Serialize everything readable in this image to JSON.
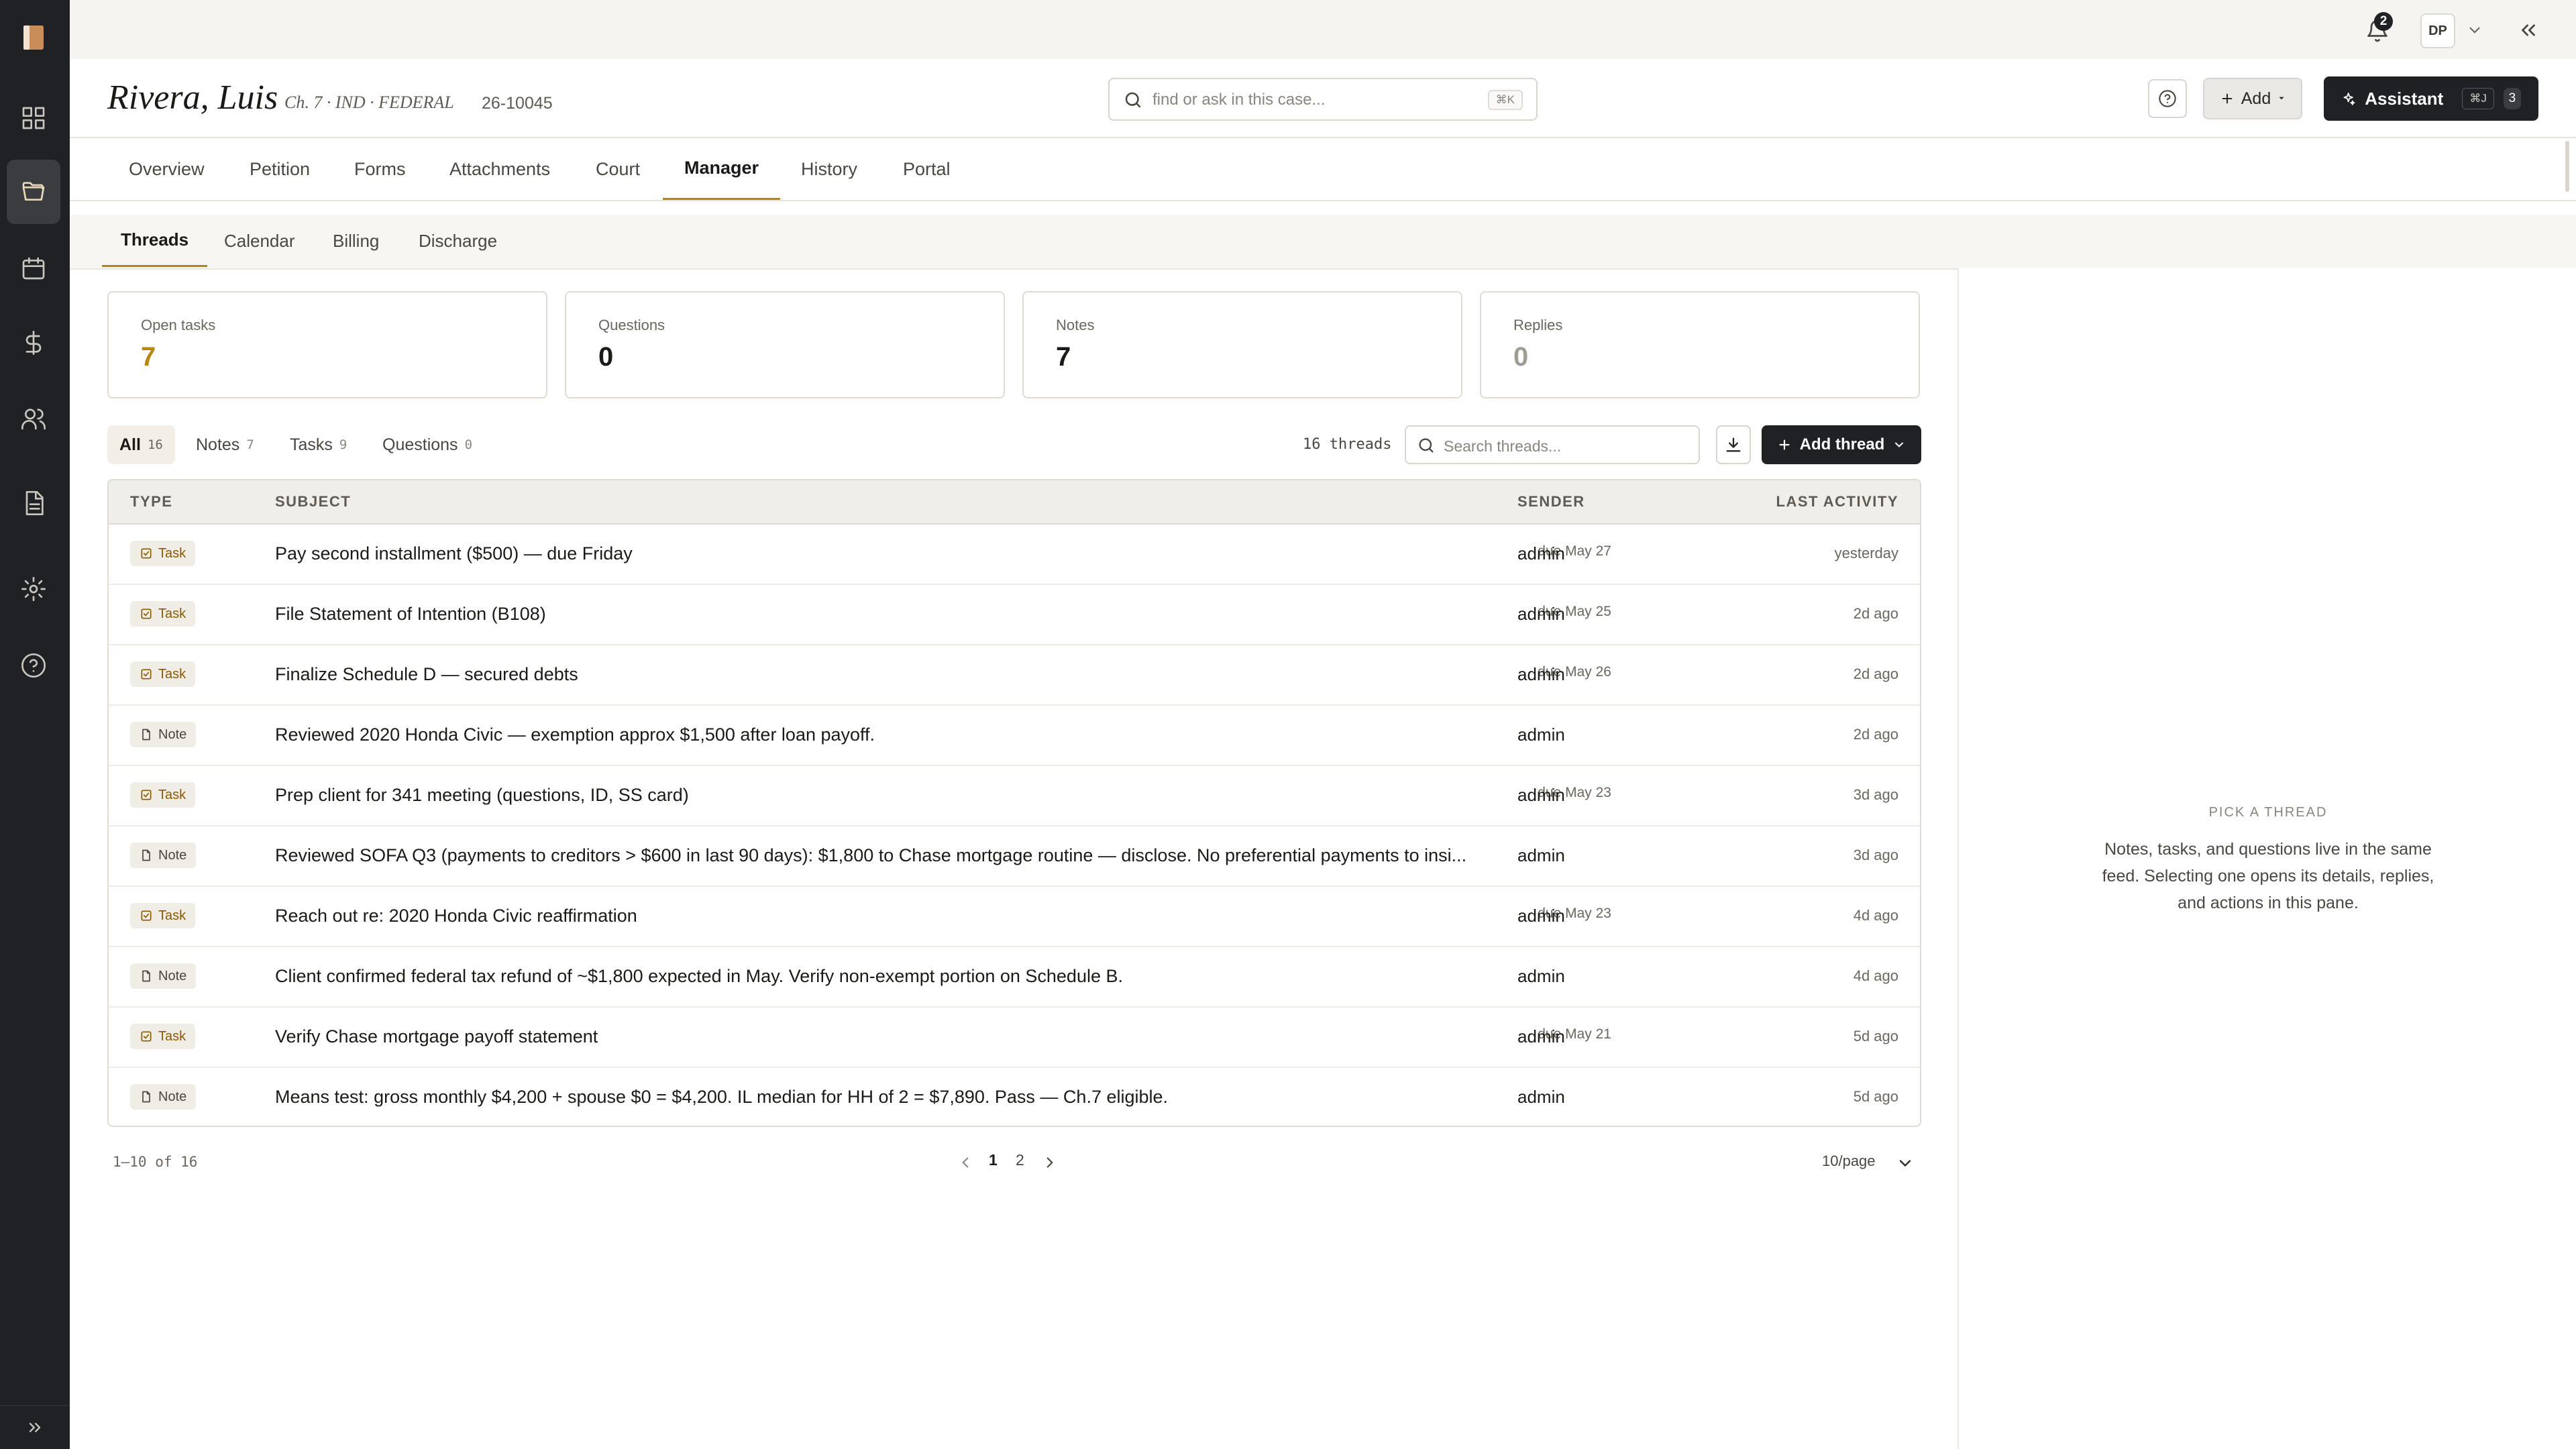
{
  "topbar": {
    "notification_count": "2",
    "avatar_initials": "DP"
  },
  "case": {
    "client_name": "Rivera, Luis",
    "meta": "Ch. 7 · IND · FEDERAL",
    "case_number": "26-10045",
    "search_placeholder": "find or ask in this case...",
    "search_shortcut": "⌘K"
  },
  "actions": {
    "add_label": "Add",
    "assistant_label": "Assistant",
    "assistant_shortcut": "⌘J",
    "assistant_count": "3"
  },
  "tabs": [
    {
      "label": "Overview"
    },
    {
      "label": "Petition"
    },
    {
      "label": "Forms"
    },
    {
      "label": "Attachments"
    },
    {
      "label": "Court"
    },
    {
      "label": "Manager"
    },
    {
      "label": "History"
    },
    {
      "label": "Portal"
    }
  ],
  "subtabs": [
    {
      "label": "Threads"
    },
    {
      "label": "Calendar"
    },
    {
      "label": "Billing"
    },
    {
      "label": "Discharge"
    }
  ],
  "stats": [
    {
      "label": "Open tasks",
      "value": "7"
    },
    {
      "label": "Questions",
      "value": "0"
    },
    {
      "label": "Notes",
      "value": "7"
    },
    {
      "label": "Replies",
      "value": "0"
    }
  ],
  "filters": [
    {
      "label": "All",
      "count": "16"
    },
    {
      "label": "Notes",
      "count": "7"
    },
    {
      "label": "Tasks",
      "count": "9"
    },
    {
      "label": "Questions",
      "count": "0"
    }
  ],
  "thread_count": "16 threads",
  "thread_search_placeholder": "Search threads...",
  "add_thread_label": "Add thread",
  "table": {
    "headers": {
      "type": "TYPE",
      "subject": "SUBJECT",
      "sender": "SENDER",
      "activity": "LAST ACTIVITY"
    },
    "rows": [
      {
        "type": "Task",
        "subject": "Pay second installment ($500) — due Friday",
        "due": "due May 27",
        "sender": "admin",
        "activity": "yesterday"
      },
      {
        "type": "Task",
        "subject": "File Statement of Intention (B108)",
        "due": "due May 25",
        "sender": "admin",
        "activity": "2d ago"
      },
      {
        "type": "Task",
        "subject": "Finalize Schedule D — secured debts",
        "due": "due May 26",
        "sender": "admin",
        "activity": "2d ago"
      },
      {
        "type": "Note",
        "subject": "Reviewed 2020 Honda Civic — exemption approx $1,500 after loan payoff.",
        "due": "",
        "sender": "admin",
        "activity": "2d ago"
      },
      {
        "type": "Task",
        "subject": "Prep client for 341 meeting (questions, ID, SS card)",
        "due": "due May 23",
        "sender": "admin",
        "activity": "3d ago"
      },
      {
        "type": "Note",
        "subject": "Reviewed SOFA Q3 (payments to creditors > $600 in last 90 days): $1,800 to Chase mortgage routine — disclose. No preferential payments to insi...",
        "due": "",
        "sender": "admin",
        "activity": "3d ago"
      },
      {
        "type": "Task",
        "subject": "Reach out re: 2020 Honda Civic reaffirmation",
        "due": "due May 23",
        "sender": "admin",
        "activity": "4d ago"
      },
      {
        "type": "Note",
        "subject": "Client confirmed federal tax refund of ~$1,800 expected in May. Verify non-exempt portion on Schedule B.",
        "due": "",
        "sender": "admin",
        "activity": "4d ago"
      },
      {
        "type": "Task",
        "subject": "Verify Chase mortgage payoff statement",
        "due": "due May 21",
        "sender": "admin",
        "activity": "5d ago"
      },
      {
        "type": "Note",
        "subject": "Means test: gross monthly $4,200 + spouse $0 = $4,200. IL median for HH of 2 = $7,890. Pass — Ch.7 eligible.",
        "due": "",
        "sender": "admin",
        "activity": "5d ago"
      }
    ]
  },
  "pagination": {
    "range": "1–10 of 16",
    "pages": [
      "1",
      "2"
    ],
    "per_page": "10/page"
  },
  "side_pane": {
    "kicker": "PICK A THREAD",
    "text": "Notes, tasks, and questions live in the same feed. Selecting one opens its details, replies, and actions in this pane."
  },
  "colors": {
    "accent": "#b8860b",
    "rail": "#1f2124",
    "task_text": "#8a5a00"
  },
  "icons": {
    "rail": [
      "dashboard-icon",
      "folder-icon",
      "calendar-icon",
      "dollar-icon",
      "users-icon",
      "document-icon",
      "gear-icon",
      "help-circle-icon"
    ],
    "expand": "double-chevron-right-icon"
  }
}
